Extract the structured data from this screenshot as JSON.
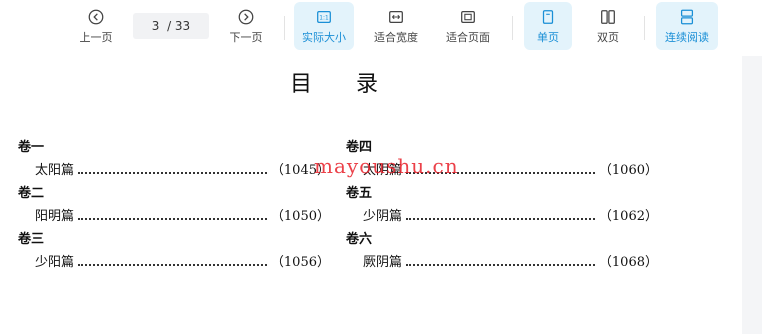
{
  "toolbar": {
    "prev_label": "上一页",
    "next_label": "下一页",
    "page_current": "3",
    "page_total": "/ 33",
    "actual_size_label": "实际大小",
    "fit_width_label": "适合宽度",
    "fit_page_label": "适合页面",
    "single_page_label": "单页",
    "double_page_label": "双页",
    "continuous_label": "连续阅读"
  },
  "doc": {
    "title": "目录",
    "left_col": [
      {
        "volume": "卷一",
        "chapter": "太阳篇",
        "page": "（1045）"
      },
      {
        "volume": "卷二",
        "chapter": "阳明篇",
        "page": "（1050）"
      },
      {
        "volume": "卷三",
        "chapter": "少阳篇",
        "page": "（1056）"
      }
    ],
    "right_col": [
      {
        "volume": "卷四",
        "chapter": "太阴篇",
        "page": "（1060）"
      },
      {
        "volume": "卷五",
        "chapter": "少阴篇",
        "page": "（1062）"
      },
      {
        "volume": "卷六",
        "chapter": "厥阴篇",
        "page": "（1068）"
      }
    ],
    "watermark": "mayoushu.cn"
  }
}
